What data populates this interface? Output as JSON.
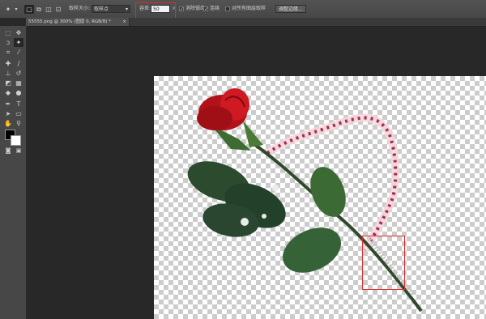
{
  "options_bar": {
    "sample_size_label": "取样大小:",
    "sample_size_value": "取样点",
    "tolerance_label": "容差:",
    "tolerance_value": "50",
    "antialias_label": "消除锯齿",
    "contiguous_label": "连续",
    "all_layers_label": "对所有图层取样",
    "refine_edge_label": "调整边缘..."
  },
  "document_tab": {
    "title": "55555.png @ 300% (图层 0, RGB/8) *",
    "close": "×"
  },
  "colors": {
    "highlight": "#e02a2a",
    "foreground": "#000000",
    "background": "#ffffff"
  }
}
